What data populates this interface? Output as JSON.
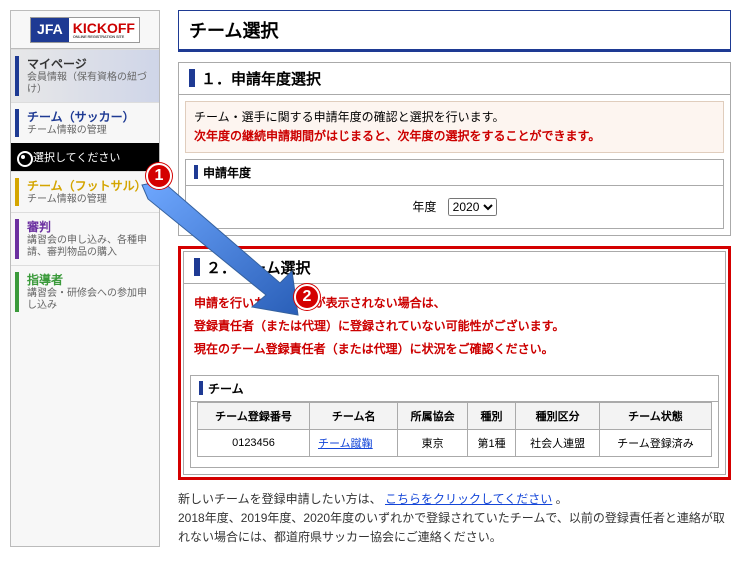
{
  "logo": {
    "jfa": "JFA",
    "kickoff": "KICKOFF",
    "small": "ONLINE REGISTRATION SITE"
  },
  "sidebar": {
    "mypage": {
      "title": "マイページ",
      "desc": "会員情報（保有資格の紐づけ）"
    },
    "soccer": {
      "title": "チーム（サッカー）",
      "desc": "チーム情報の管理"
    },
    "select": "選択してください",
    "futsal": {
      "title": "チーム（フットサル）",
      "desc": "チーム情報の管理"
    },
    "referee": {
      "title": "審判",
      "desc": "講習会の申し込み、各種申請、審判物品の購入"
    },
    "coach": {
      "title": "指導者",
      "desc": "講習会・研修会への参加申し込み"
    }
  },
  "page": {
    "title": "チーム選択",
    "sec1": {
      "title": "１．申請年度選択",
      "note1": "チーム・選手に関する申請年度の確認と選択を行います。",
      "note2": "次年度の継続申請期間がはじまると、次年度の選択をすることができます。",
      "year_head": "申請年度",
      "year_label": "年度",
      "year_value": "2020"
    },
    "sec2": {
      "title": "２．チーム選択",
      "warn1": "申請を行いたいチームが表示されない場合は、",
      "warn2": "登録責任者（または代理）に登録されていない可能性がございます。",
      "warn3": "現在のチーム登録責任者（または代理）に状況をご確認ください。",
      "team_head": "チーム",
      "headers": {
        "no": "チーム登録番号",
        "name": "チーム名",
        "assoc": "所属協会",
        "type": "種別",
        "cat": "種別区分",
        "status": "チーム状態"
      },
      "row": {
        "no": "0123456",
        "name": "チーム蹴鞠",
        "assoc": "東京",
        "type": "第1種",
        "cat": "社会人連盟",
        "status": "チーム登録済み"
      }
    },
    "foot": {
      "lead": "新しいチームを登録申請したい方は、",
      "link": "こちらをクリックしてください",
      "period": "。",
      "tail": "2018年度、2019年度、2020年度のいずれかで登録されていたチームで、以前の登録責任者と連絡が取れない場合には、都道府県サッカー協会にご連絡ください。"
    }
  },
  "badges": {
    "b1": "1",
    "b2": "2"
  }
}
